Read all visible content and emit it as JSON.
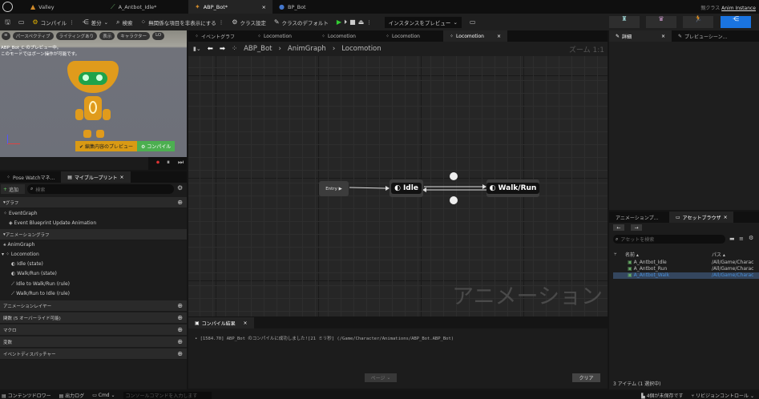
{
  "titlebar": {
    "tabs": [
      {
        "label": "Valley"
      },
      {
        "label": "A_Antbot_Idle*"
      },
      {
        "label": "ABP_Bot*"
      },
      {
        "label": "BP_Bot"
      }
    ],
    "parent_class_label": "親クラス",
    "parent_class_value": "Anim Instance"
  },
  "toolbar": {
    "compile": "コンパイル",
    "diff": "差分",
    "search": "検索",
    "hide_unrelated": "無関係な項目を非表示にする",
    "class_settings": "クラス設定",
    "class_defaults": "クラスのデフォルト",
    "preview_instance": "インスタンスをプレビュー"
  },
  "viewport": {
    "perspective": "パースペクティブ",
    "lighting": "ライティングあり",
    "show": "表示",
    "character": "キャラクター",
    "lod": "LO",
    "overlay1": "ABP_Bot_C のプレビュー中。",
    "overlay2": "このモードではボーン操作が可能です。",
    "edit_preview": "編集内容のプレビュー",
    "compile_btn": "コンパイル"
  },
  "left_tabs": {
    "pose_watch": "Pose Watchマネ...",
    "my_blueprint": "マイブループリント"
  },
  "my_blueprint": {
    "add": "追加",
    "search_placeholder": "検索",
    "graphs_header": "グラフ",
    "event_graph": "EventGraph",
    "event_update": "Event Blueprint Update Animation",
    "anim_graphs_header": "アニメーショングラフ",
    "anim_graph": "AnimGraph",
    "locomotion": "Locomotion",
    "items": [
      "Idle (state)",
      "Walk/Run (state)",
      "Idle to Walk/Run (rule)",
      "Walk/Run to Idle (rule)"
    ],
    "sections": [
      "アニメーションレイヤー",
      "関数 (5 オーバーライド可能)",
      "マクロ",
      "変数",
      "イベントディスパッチャー"
    ]
  },
  "graph_tabs": [
    "イベントグラフ",
    "Locomotion",
    "Locomotion",
    "Locomotion",
    "Locomotion"
  ],
  "breadcrumb": [
    "ABP_Bot",
    "AnimGraph",
    "Locomotion"
  ],
  "graph": {
    "zoom": "ズーム 1:1",
    "watermark": "アニメーション",
    "entry": "Entry",
    "states": [
      "Idle",
      "Walk/Run"
    ]
  },
  "compile_results": {
    "tab": "コンパイル結果",
    "message": "[1584.70] ABP_Bot のコンパイルに成功しました![21 ミリ秒] (/Game/Character/Animations/ABP_Bot.ABP_Bot)",
    "page": "ページ",
    "clear": "クリア"
  },
  "right_tabs": {
    "details": "詳細",
    "preview_scene": "プレビューシーン..."
  },
  "asset_browser": {
    "tab_anim": "アニメーションプ...",
    "tab_assets": "アセットブラウザ",
    "search_placeholder": "アセットを検索",
    "col_name": "名前",
    "col_path": "パス",
    "rows": [
      {
        "name": "A_Antbot_Idle",
        "path": "/All/Game/Charac"
      },
      {
        "name": "A_Antbot_Run",
        "path": "/All/Game/Charac"
      },
      {
        "name": "A_Antbot_Walk",
        "path": "/All/Game/Charac"
      }
    ],
    "footer": "3 アイテム (1 選択中)"
  },
  "statusbar": {
    "content_drawer": "コンテンツドロワー",
    "output_log": "出力ログ",
    "cmd": "Cmd",
    "console_placeholder": "コンソールコマンドを入力します",
    "unsaved": "4個が未保存です",
    "revision": "リビジョンコントロール"
  }
}
